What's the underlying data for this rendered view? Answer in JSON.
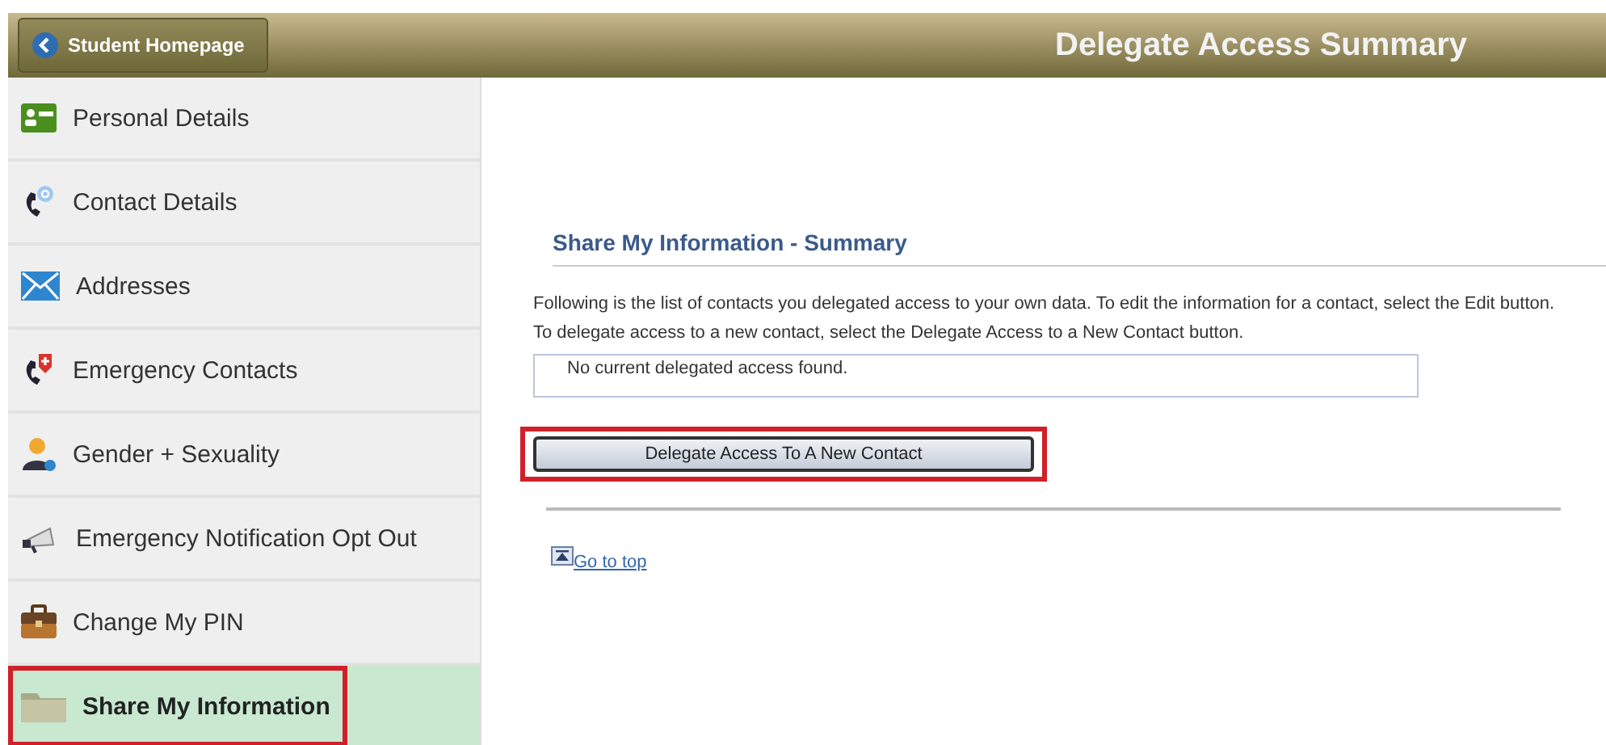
{
  "header": {
    "back_button": "Student Homepage",
    "title": "Delegate Access Summary"
  },
  "sidebar": {
    "items": [
      {
        "label": "Personal Details",
        "selected": false,
        "highlighted": false
      },
      {
        "label": "Contact Details",
        "selected": false,
        "highlighted": false
      },
      {
        "label": "Addresses",
        "selected": false,
        "highlighted": false
      },
      {
        "label": "Emergency Contacts",
        "selected": false,
        "highlighted": false
      },
      {
        "label": "Gender + Sexuality",
        "selected": false,
        "highlighted": false
      },
      {
        "label": "Emergency Notification Opt Out",
        "selected": false,
        "highlighted": false
      },
      {
        "label": "Change My PIN",
        "selected": false,
        "highlighted": false
      },
      {
        "label": "Share My Information",
        "selected": true,
        "highlighted": true
      }
    ]
  },
  "main": {
    "section_title": "Share My Information - Summary",
    "description": "Following is the list of contacts you delegated access to your own data. To edit the information for a contact, select the Edit button. To delegate access to a new contact, select the Delegate Access to a New Contact button.",
    "empty_message": "No current delegated access found.",
    "action_button": {
      "label": "Delegate Access To A New Contact",
      "highlighted": true
    },
    "go_to_top": "Go to top"
  }
}
